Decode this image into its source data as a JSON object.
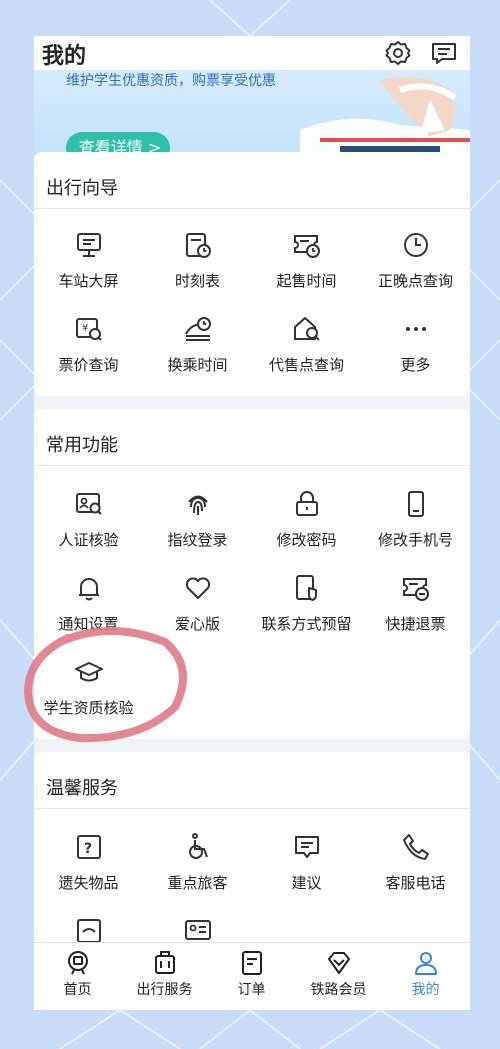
{
  "header": {
    "title": "我的"
  },
  "banner": {
    "subtitle": "维护学生优惠资质，购票享受优惠",
    "button_label": "查看详情 >"
  },
  "sections": {
    "travel": {
      "title": "出行向导",
      "items": [
        {
          "label": "车站大屏",
          "icon": "station-screen-icon"
        },
        {
          "label": "时刻表",
          "icon": "timetable-icon"
        },
        {
          "label": "起售时间",
          "icon": "sale-time-icon"
        },
        {
          "label": "正晚点查询",
          "icon": "clock-icon"
        },
        {
          "label": "票价查询",
          "icon": "price-search-icon"
        },
        {
          "label": "换乘时间",
          "icon": "transfer-time-icon"
        },
        {
          "label": "代售点查询",
          "icon": "agency-search-icon"
        },
        {
          "label": "更多",
          "icon": "more-icon"
        }
      ]
    },
    "common": {
      "title": "常用功能",
      "items": [
        {
          "label": "人证核验",
          "icon": "id-verify-icon"
        },
        {
          "label": "指纹登录",
          "icon": "fingerprint-icon"
        },
        {
          "label": "修改密码",
          "icon": "lock-icon"
        },
        {
          "label": "修改手机号",
          "icon": "phone-icon"
        },
        {
          "label": "通知设置",
          "icon": "bell-icon"
        },
        {
          "label": "爱心版",
          "icon": "heart-icon"
        },
        {
          "label": "联系方式预留",
          "icon": "contact-reserve-icon"
        },
        {
          "label": "快捷退票",
          "icon": "quick-refund-icon"
        },
        {
          "label": "学生资质核验",
          "icon": "graduation-cap-icon"
        }
      ]
    },
    "service": {
      "title": "温馨服务",
      "items": [
        {
          "label": "遗失物品",
          "icon": "lost-item-icon"
        },
        {
          "label": "重点旅客",
          "icon": "wheelchair-icon"
        },
        {
          "label": "建议",
          "icon": "suggestion-icon"
        },
        {
          "label": "客服电话",
          "icon": "phone-call-icon"
        }
      ]
    }
  },
  "tabbar": {
    "items": [
      {
        "label": "首页",
        "icon": "home-train-icon"
      },
      {
        "label": "出行服务",
        "icon": "luggage-icon"
      },
      {
        "label": "订单",
        "icon": "order-icon"
      },
      {
        "label": "铁路会员",
        "icon": "diamond-icon"
      },
      {
        "label": "我的",
        "icon": "user-icon"
      }
    ],
    "active_index": 4
  },
  "colors": {
    "accent": "#3a87d9",
    "banner_button": "#2fc0a9",
    "annotation": "#e07a8a"
  }
}
